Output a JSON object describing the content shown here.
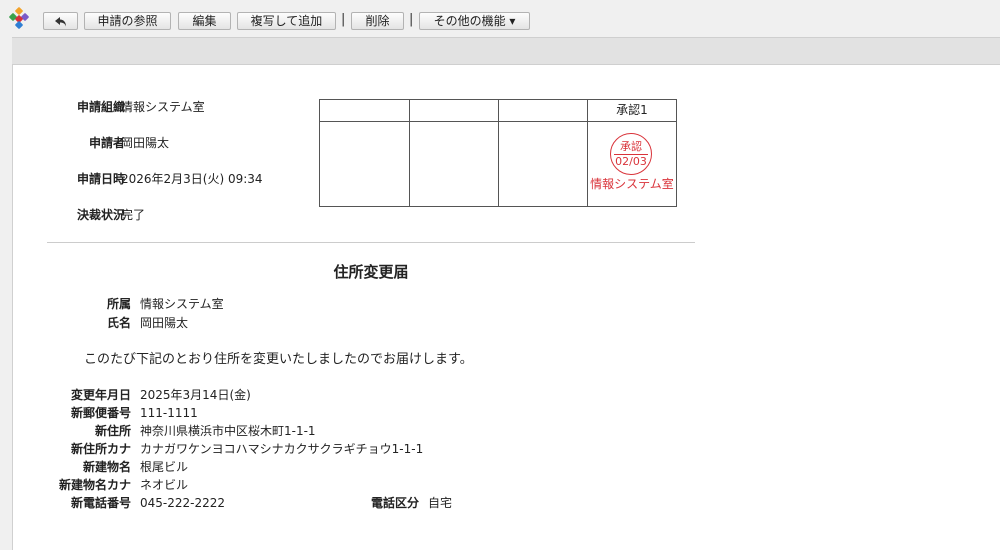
{
  "toolbar": {
    "back_label": "↰",
    "buttons": [
      "申請の参照",
      "編集",
      "複写して追加",
      "削除",
      "その他の機能 ▾"
    ],
    "separator": "|"
  },
  "application_info": [
    {
      "label": "申請組織",
      "value": "情報システム室"
    },
    {
      "label": "申請者",
      "value": "岡田陽太"
    },
    {
      "label": "申請日時",
      "value": "2026年2月3日(火) 09:34"
    },
    {
      "label": "決裁状況",
      "value": "完了"
    }
  ],
  "approval": {
    "column_header": "承認1",
    "stamp_label": "承認",
    "stamp_date": "02/03",
    "stamp_org": "情報システム室",
    "stamp_color": "#d9333a"
  },
  "form": {
    "title": "住所変更届",
    "header_fields": [
      {
        "label": "所属",
        "value": "情報システム室"
      },
      {
        "label": "氏名",
        "value": "岡田陽太"
      }
    ],
    "notice": "このたび下記のとおり住所を変更いたしましたのでお届けします。",
    "fields": [
      {
        "label": "変更年月日",
        "value": "2025年3月14日(金)"
      },
      {
        "label": "新郵便番号",
        "value": "111-1111"
      },
      {
        "label": "新住所",
        "value": "神奈川県横浜市中区桜木町1-1-1"
      },
      {
        "label": "新住所カナ",
        "value": "カナガワケンヨコハマシナカクサクラギチョウ1-1-1"
      },
      {
        "label": "新建物名",
        "value": "根尾ビル"
      },
      {
        "label": "新建物名カナ",
        "value": "ネオビル"
      },
      {
        "label": "新電話番号",
        "value": "045-222-2222"
      }
    ],
    "phone_type": {
      "label": "電話区分",
      "value": "自宅"
    }
  }
}
